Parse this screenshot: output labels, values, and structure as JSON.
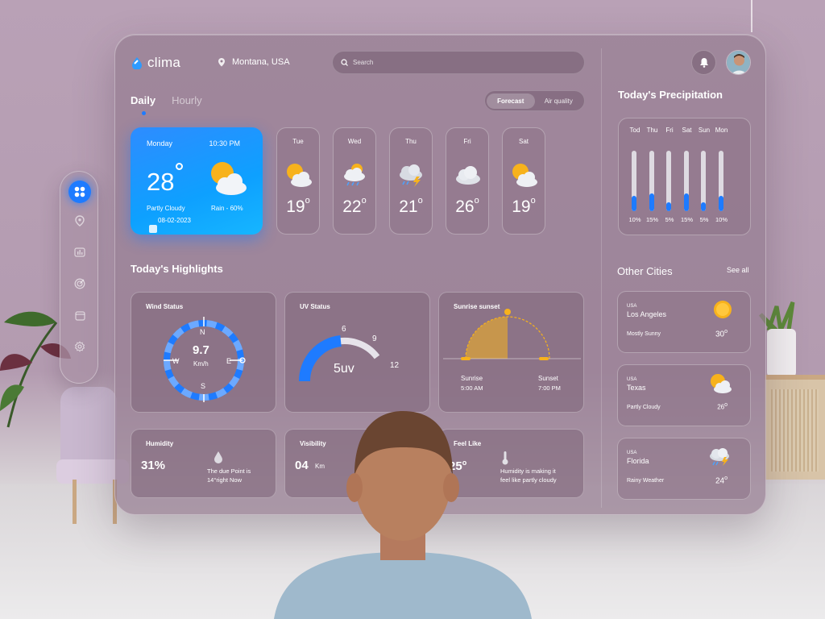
{
  "app": {
    "name": "clima"
  },
  "header": {
    "location": "Montana, USA",
    "search_placeholder": "Search"
  },
  "tabs": [
    {
      "label": "Daily",
      "active": true
    },
    {
      "label": "Hourly",
      "active": false
    }
  ],
  "view_toggle": [
    {
      "label": "Forecast",
      "active": true
    },
    {
      "label": "Air quality",
      "active": false
    }
  ],
  "today": {
    "day": "Monday",
    "time": "10:30 PM",
    "temp": "28",
    "condition": "Partly Cloudy",
    "rain": "Rain - 60%",
    "date": "08-02-2023"
  },
  "forecast": [
    {
      "day": "Tue",
      "temp": "19",
      "icon": "partly-cloudy-icon"
    },
    {
      "day": "Wed",
      "temp": "22",
      "icon": "rain-sun-icon"
    },
    {
      "day": "Thu",
      "temp": "21",
      "icon": "thunderstorm-icon"
    },
    {
      "day": "Fri",
      "temp": "26",
      "icon": "cloud-icon"
    },
    {
      "day": "Sat",
      "temp": "19",
      "icon": "partly-cloudy-icon"
    }
  ],
  "highlights": {
    "title": "Today's Highlights",
    "wind": {
      "title": "Wind Status",
      "value": "9.7",
      "unit": "Km/h",
      "n": "N",
      "s": "S",
      "e": "E",
      "w": "W"
    },
    "uv": {
      "title": "UV Status",
      "value": "5uv",
      "tick_6": "6",
      "tick_9": "9",
      "tick_12": "12",
      "level": 0.45
    },
    "sun": {
      "title": "Sunrise sunset",
      "sunrise_label": "Sunrise",
      "sunrise_time": "5:00 AM",
      "sunset_label": "Sunset",
      "sunset_time": "7:00 PM"
    },
    "humidity": {
      "title": "Humidity",
      "value": "31%",
      "note_line1": "The due Point is",
      "note_line2": "14°right Now"
    },
    "visibility": {
      "title": "Visibility",
      "value": "04",
      "unit": "Km"
    },
    "feel": {
      "title": "Feel Like",
      "value": "25",
      "note_line1": "Humidity is making it",
      "note_line2": "feel like partly cloudy"
    }
  },
  "precipitation": {
    "title": "Today's  Precipitation",
    "days": [
      {
        "day": "Tod",
        "value": "10%",
        "level": 0.25
      },
      {
        "day": "Thu",
        "value": "15%",
        "level": 0.3
      },
      {
        "day": "Fri",
        "value": "5%",
        "level": 0.15
      },
      {
        "day": "Sat",
        "value": "15%",
        "level": 0.3
      },
      {
        "day": "Sun",
        "value": "5%",
        "level": 0.15
      },
      {
        "day": "Mon",
        "value": "10%",
        "level": 0.25
      }
    ]
  },
  "other_cities": {
    "title": "Other Cities",
    "see_all": "See all",
    "cities": [
      {
        "country": "USA",
        "name": "Los Angeles",
        "condition": "Mostly Sunny",
        "temp": "30",
        "icon": "sun-icon"
      },
      {
        "country": "USA",
        "name": "Texas",
        "condition": "Partly Cloudy",
        "temp": "26",
        "icon": "partly-cloudy-icon"
      },
      {
        "country": "USA",
        "name": "Florida",
        "condition": "Rainy Weather",
        "temp": "24",
        "icon": "thunderstorm-icon"
      }
    ]
  },
  "colors": {
    "accent": "#1e7bff",
    "sun": "#f7b21c",
    "panel": "#967d91"
  }
}
